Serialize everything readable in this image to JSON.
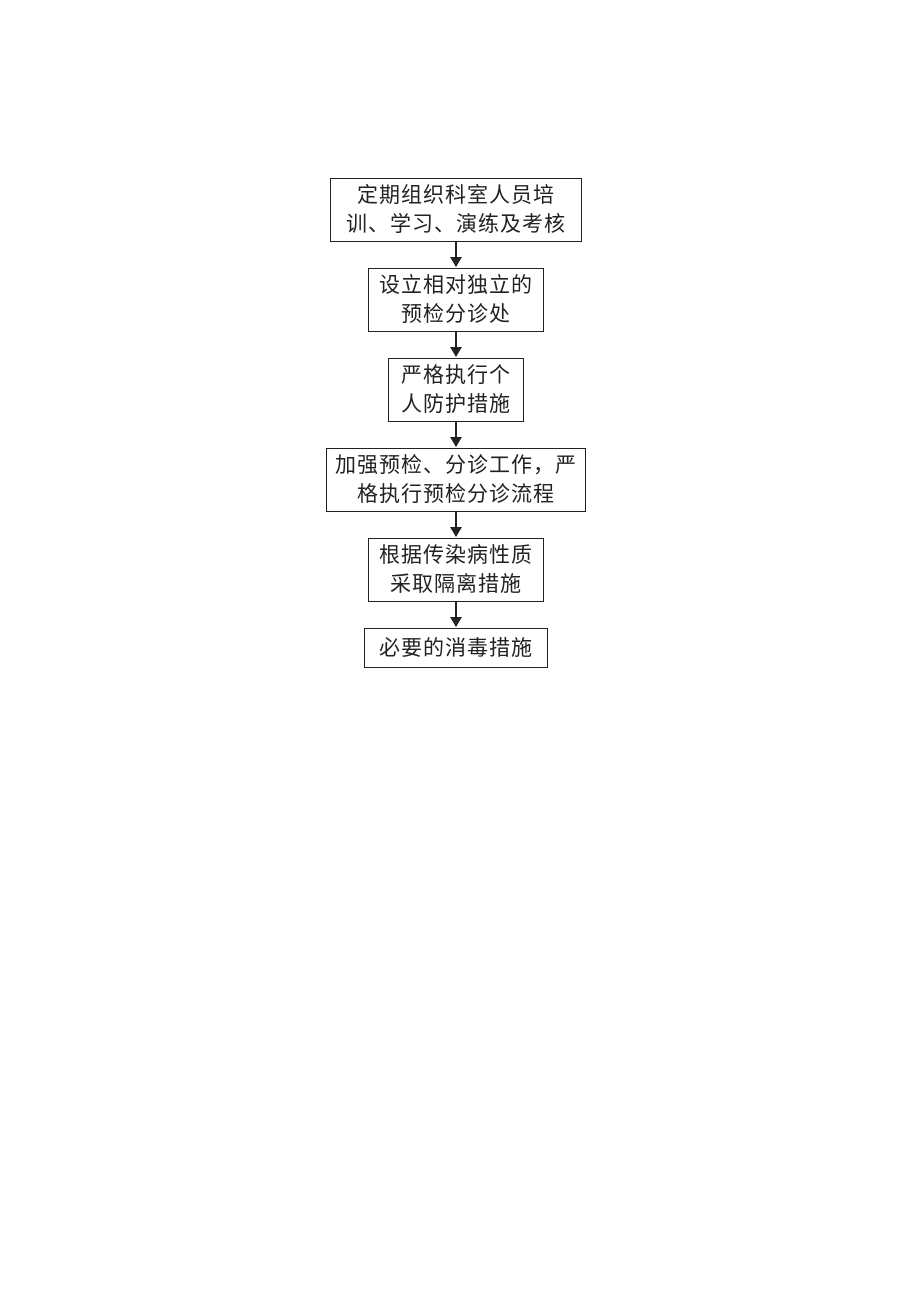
{
  "flowchart": {
    "steps": [
      {
        "text": "定期组织科室人员培训、学习、演练及考核"
      },
      {
        "text": "设立相对独立的预检分诊处"
      },
      {
        "text": "严格执行个人防护措施"
      },
      {
        "text": "加强预检、分诊工作，严格执行预检分诊流程"
      },
      {
        "text": "根据传染病性质采取隔离措施"
      },
      {
        "text": "必要的消毒措施"
      }
    ]
  }
}
